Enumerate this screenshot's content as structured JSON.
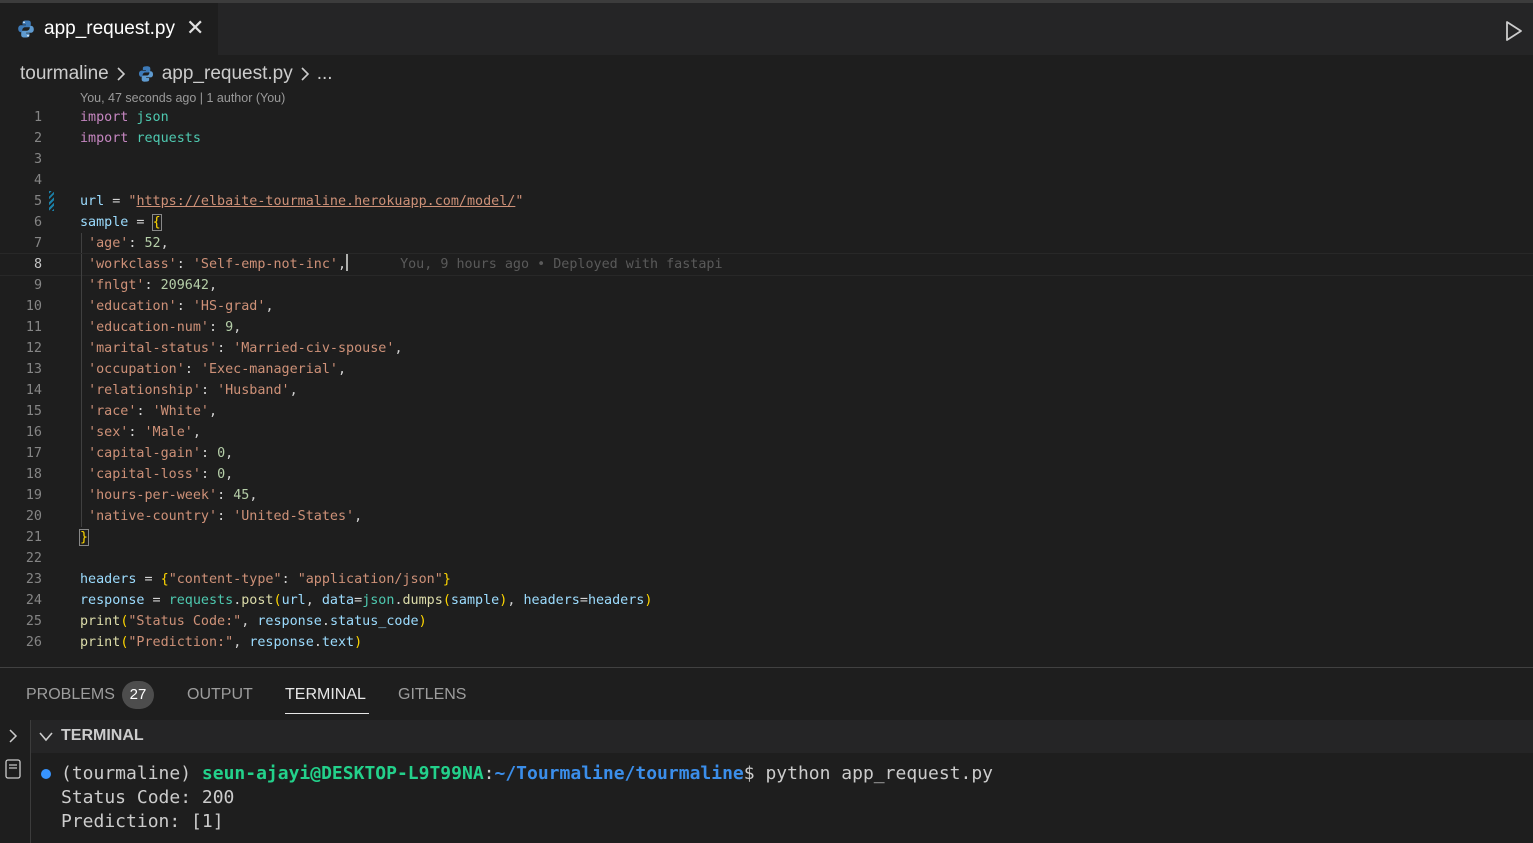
{
  "tab": {
    "filename": "app_request.py"
  },
  "breadcrumb": {
    "folder": "tourmaline",
    "file": "app_request.py",
    "more": "..."
  },
  "blame_header": "You, 47 seconds ago | 1 author (You)",
  "inline_blame": "You, 9 hours ago • Deployed with fastapi",
  "lines": [
    [
      [
        "kw",
        "import"
      ],
      [
        "pun",
        " "
      ],
      [
        "mod",
        "json"
      ]
    ],
    [
      [
        "kw",
        "import"
      ],
      [
        "pun",
        " "
      ],
      [
        "mod",
        "requests"
      ]
    ],
    [],
    [],
    [
      [
        "var",
        "url"
      ],
      [
        "pun",
        " = "
      ],
      [
        "str",
        "\""
      ],
      [
        "str url",
        "https://elbaite-tourmaline.herokuapp.com/model/"
      ],
      [
        "str",
        "\""
      ]
    ],
    [
      [
        "var",
        "sample"
      ],
      [
        "pun",
        " = "
      ],
      [
        "br bracket-box",
        "{"
      ]
    ],
    [
      [
        "pun",
        " "
      ],
      [
        "str",
        "'age'"
      ],
      [
        "pun",
        ": "
      ],
      [
        "num",
        "52"
      ],
      [
        "pun",
        ","
      ]
    ],
    [
      [
        "pun",
        " "
      ],
      [
        "str",
        "'workclass'"
      ],
      [
        "pun",
        ": "
      ],
      [
        "str",
        "'Self-emp-not-inc'"
      ],
      [
        "pun",
        ","
      ]
    ],
    [
      [
        "pun",
        " "
      ],
      [
        "str",
        "'fnlgt'"
      ],
      [
        "pun",
        ": "
      ],
      [
        "num",
        "209642"
      ],
      [
        "pun",
        ","
      ]
    ],
    [
      [
        "pun",
        " "
      ],
      [
        "str",
        "'education'"
      ],
      [
        "pun",
        ": "
      ],
      [
        "str",
        "'HS-grad'"
      ],
      [
        "pun",
        ","
      ]
    ],
    [
      [
        "pun",
        " "
      ],
      [
        "str",
        "'education-num'"
      ],
      [
        "pun",
        ": "
      ],
      [
        "num",
        "9"
      ],
      [
        "pun",
        ","
      ]
    ],
    [
      [
        "pun",
        " "
      ],
      [
        "str",
        "'marital-status'"
      ],
      [
        "pun",
        ": "
      ],
      [
        "str",
        "'Married-civ-spouse'"
      ],
      [
        "pun",
        ","
      ]
    ],
    [
      [
        "pun",
        " "
      ],
      [
        "str",
        "'occupation'"
      ],
      [
        "pun",
        ": "
      ],
      [
        "str",
        "'Exec-managerial'"
      ],
      [
        "pun",
        ","
      ]
    ],
    [
      [
        "pun",
        " "
      ],
      [
        "str",
        "'relationship'"
      ],
      [
        "pun",
        ": "
      ],
      [
        "str",
        "'Husband'"
      ],
      [
        "pun",
        ","
      ]
    ],
    [
      [
        "pun",
        " "
      ],
      [
        "str",
        "'race'"
      ],
      [
        "pun",
        ": "
      ],
      [
        "str",
        "'White'"
      ],
      [
        "pun",
        ","
      ]
    ],
    [
      [
        "pun",
        " "
      ],
      [
        "str",
        "'sex'"
      ],
      [
        "pun",
        ": "
      ],
      [
        "str",
        "'Male'"
      ],
      [
        "pun",
        ","
      ]
    ],
    [
      [
        "pun",
        " "
      ],
      [
        "str",
        "'capital-gain'"
      ],
      [
        "pun",
        ": "
      ],
      [
        "num",
        "0"
      ],
      [
        "pun",
        ","
      ]
    ],
    [
      [
        "pun",
        " "
      ],
      [
        "str",
        "'capital-loss'"
      ],
      [
        "pun",
        ": "
      ],
      [
        "num",
        "0"
      ],
      [
        "pun",
        ","
      ]
    ],
    [
      [
        "pun",
        " "
      ],
      [
        "str",
        "'hours-per-week'"
      ],
      [
        "pun",
        ": "
      ],
      [
        "num",
        "45"
      ],
      [
        "pun",
        ","
      ]
    ],
    [
      [
        "pun",
        " "
      ],
      [
        "str",
        "'native-country'"
      ],
      [
        "pun",
        ": "
      ],
      [
        "str",
        "'United-States'"
      ],
      [
        "pun",
        ","
      ]
    ],
    [
      [
        "br bracket-box",
        "}"
      ]
    ],
    [],
    [
      [
        "var",
        "headers"
      ],
      [
        "pun",
        " = "
      ],
      [
        "br",
        "{"
      ],
      [
        "str",
        "\"content-type\""
      ],
      [
        "pun",
        ": "
      ],
      [
        "str",
        "\"application/json\""
      ],
      [
        "br",
        "}"
      ]
    ],
    [
      [
        "var",
        "response"
      ],
      [
        "pun",
        " = "
      ],
      [
        "mod",
        "requests"
      ],
      [
        "pun",
        "."
      ],
      [
        "fn",
        "post"
      ],
      [
        "br",
        "("
      ],
      [
        "var",
        "url"
      ],
      [
        "pun",
        ", "
      ],
      [
        "var",
        "data"
      ],
      [
        "pun",
        "="
      ],
      [
        "mod",
        "json"
      ],
      [
        "pun",
        "."
      ],
      [
        "fn",
        "dumps"
      ],
      [
        "br",
        "("
      ],
      [
        "var",
        "sample"
      ],
      [
        "br",
        ")"
      ],
      [
        "pun",
        ", "
      ],
      [
        "var",
        "headers"
      ],
      [
        "pun",
        "="
      ],
      [
        "var",
        "headers"
      ],
      [
        "br",
        ")"
      ]
    ],
    [
      [
        "fn",
        "print"
      ],
      [
        "br",
        "("
      ],
      [
        "str",
        "\"Status Code:\""
      ],
      [
        "pun",
        ", "
      ],
      [
        "var",
        "response"
      ],
      [
        "pun",
        "."
      ],
      [
        "var",
        "status_code"
      ],
      [
        "br",
        ")"
      ]
    ],
    [
      [
        "fn",
        "print"
      ],
      [
        "br",
        "("
      ],
      [
        "str",
        "\"Prediction:\""
      ],
      [
        "pun",
        ", "
      ],
      [
        "var",
        "response"
      ],
      [
        "pun",
        "."
      ],
      [
        "var",
        "text"
      ],
      [
        "br",
        ")"
      ]
    ]
  ],
  "current_line": 8,
  "panel": {
    "tabs": [
      "PROBLEMS",
      "OUTPUT",
      "TERMINAL",
      "GITLENS"
    ],
    "problems_count": "27",
    "active_tab": "TERMINAL",
    "terminal_title": "TERMINAL"
  },
  "terminal": {
    "env": "(tourmaline) ",
    "user": "seun-ajayi@DESKTOP-L9T99NA",
    "colon": ":",
    "path": "~/Tourmaline/tourmaline",
    "prompt_end": "$ ",
    "command": "python app_request.py",
    "out1": "Status Code: 200",
    "out2": "Prediction: [1]"
  },
  "colors": {
    "accent": "#3794ff",
    "string": "#ce9178",
    "keyword": "#c586c0",
    "module": "#4ec9b0"
  }
}
